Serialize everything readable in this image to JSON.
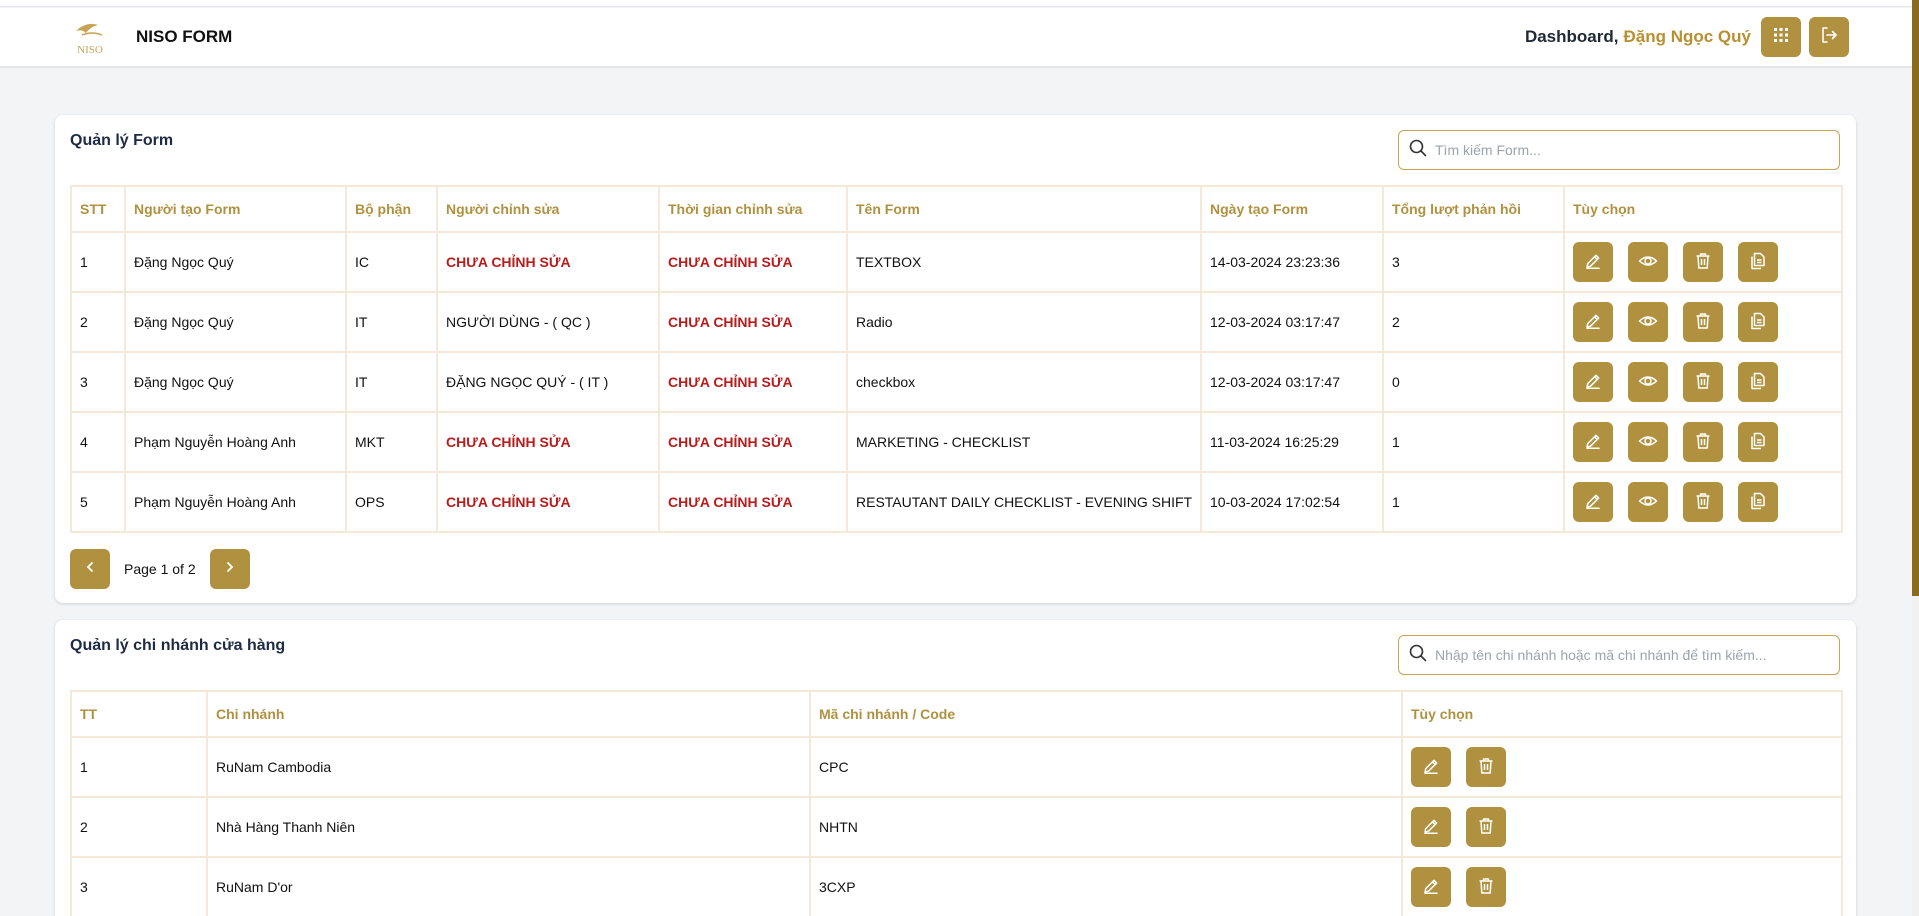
{
  "header": {
    "brand": "NISO FORM",
    "dashboard_label": "Dashboard,",
    "user_name": "Đặng Ngọc Quý",
    "apps_icon": "grid-icon",
    "logout_icon": "logout-icon"
  },
  "colors": {
    "accent": "#b0913f",
    "user_name": "#b8902f",
    "unedited_red": "#b91c1c",
    "border": "#f6e8d6"
  },
  "forms": {
    "title": "Quản lý Form",
    "search_placeholder": "Tìm kiếm Form...",
    "columns": [
      "STT",
      "Người tạo Form",
      "Bộ phận",
      "Người chỉnh sửa",
      "Thời gian chỉnh sửa",
      "Tên Form",
      "Ngày tạo Form",
      "Tổng lượt phản hồi",
      "Tùy chọn"
    ],
    "rows": [
      {
        "stt": "1",
        "creator": "Đặng Ngọc Quý",
        "dept": "IC",
        "editor": "CHƯA CHỈNH SỬA",
        "edit_time": "CHƯA CHỈNH SỬA",
        "name": "TEXTBOX",
        "created": "14-03-2024 23:23:36",
        "responses": "3"
      },
      {
        "stt": "2",
        "creator": "Đặng Ngọc Quý",
        "dept": "IT",
        "editor": "NGƯỜI DÙNG - ( QC )",
        "edit_time": "CHƯA CHỈNH SỬA",
        "name": "Radio",
        "created": "12-03-2024 03:17:47",
        "responses": "2"
      },
      {
        "stt": "3",
        "creator": "Đặng Ngọc Quý",
        "dept": "IT",
        "editor": "ĐẶNG NGỌC QUÝ - ( IT )",
        "edit_time": "CHƯA CHỈNH SỬA",
        "name": "checkbox",
        "created": "12-03-2024 03:17:47",
        "responses": "0"
      },
      {
        "stt": "4",
        "creator": "Phạm Nguyễn Hoàng Anh",
        "dept": "MKT",
        "editor": "CHƯA CHỈNH SỬA",
        "edit_time": "CHƯA CHỈNH SỬA",
        "name": "MARKETING - CHECKLIST",
        "created": "11-03-2024 16:25:29",
        "responses": "1"
      },
      {
        "stt": "5",
        "creator": "Phạm Nguyễn Hoàng Anh",
        "dept": "OPS",
        "editor": "CHƯA CHỈNH SỬA",
        "edit_time": "CHƯA CHỈNH SỬA",
        "name": "RESTAUTANT DAILY CHECKLIST - EVENING SHIFT",
        "created": "10-03-2024 17:02:54",
        "responses": "1"
      }
    ],
    "row_actions": [
      "edit-icon",
      "eye-icon",
      "trash-icon",
      "copy-icon"
    ],
    "pagination": "Page 1 of 2"
  },
  "branches": {
    "title": "Quản lý chi nhánh cửa hàng",
    "search_placeholder": "Nhập tên chi nhánh hoặc mã chi nhánh để tìm kiếm...",
    "columns": [
      "TT",
      "Chi nhánh",
      "Mã chi nhánh / Code",
      "Tùy chọn"
    ],
    "rows": [
      {
        "tt": "1",
        "name": "RuNam Cambodia",
        "code": "CPC"
      },
      {
        "tt": "2",
        "name": "Nhà Hàng Thanh Niên",
        "code": "NHTN"
      },
      {
        "tt": "3",
        "name": "RuNam D'or",
        "code": "3CXP"
      }
    ],
    "row_actions": [
      "edit-icon",
      "trash-icon"
    ]
  }
}
